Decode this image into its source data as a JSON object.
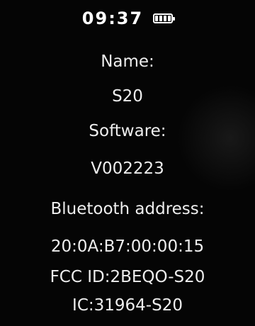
{
  "status": {
    "time": "09:37",
    "battery_icon": "battery-full-icon",
    "battery_level": 1.0
  },
  "info": {
    "name_label": "Name:",
    "name_value": "S20",
    "software_label": "Software:",
    "software_value": "V002223",
    "bluetooth_label": "Bluetooth address:",
    "bluetooth_value": "20:0A:B7:00:00:15",
    "fcc_id": "FCC ID:2BEQO-S20",
    "ic": "IC:31964-S20"
  }
}
